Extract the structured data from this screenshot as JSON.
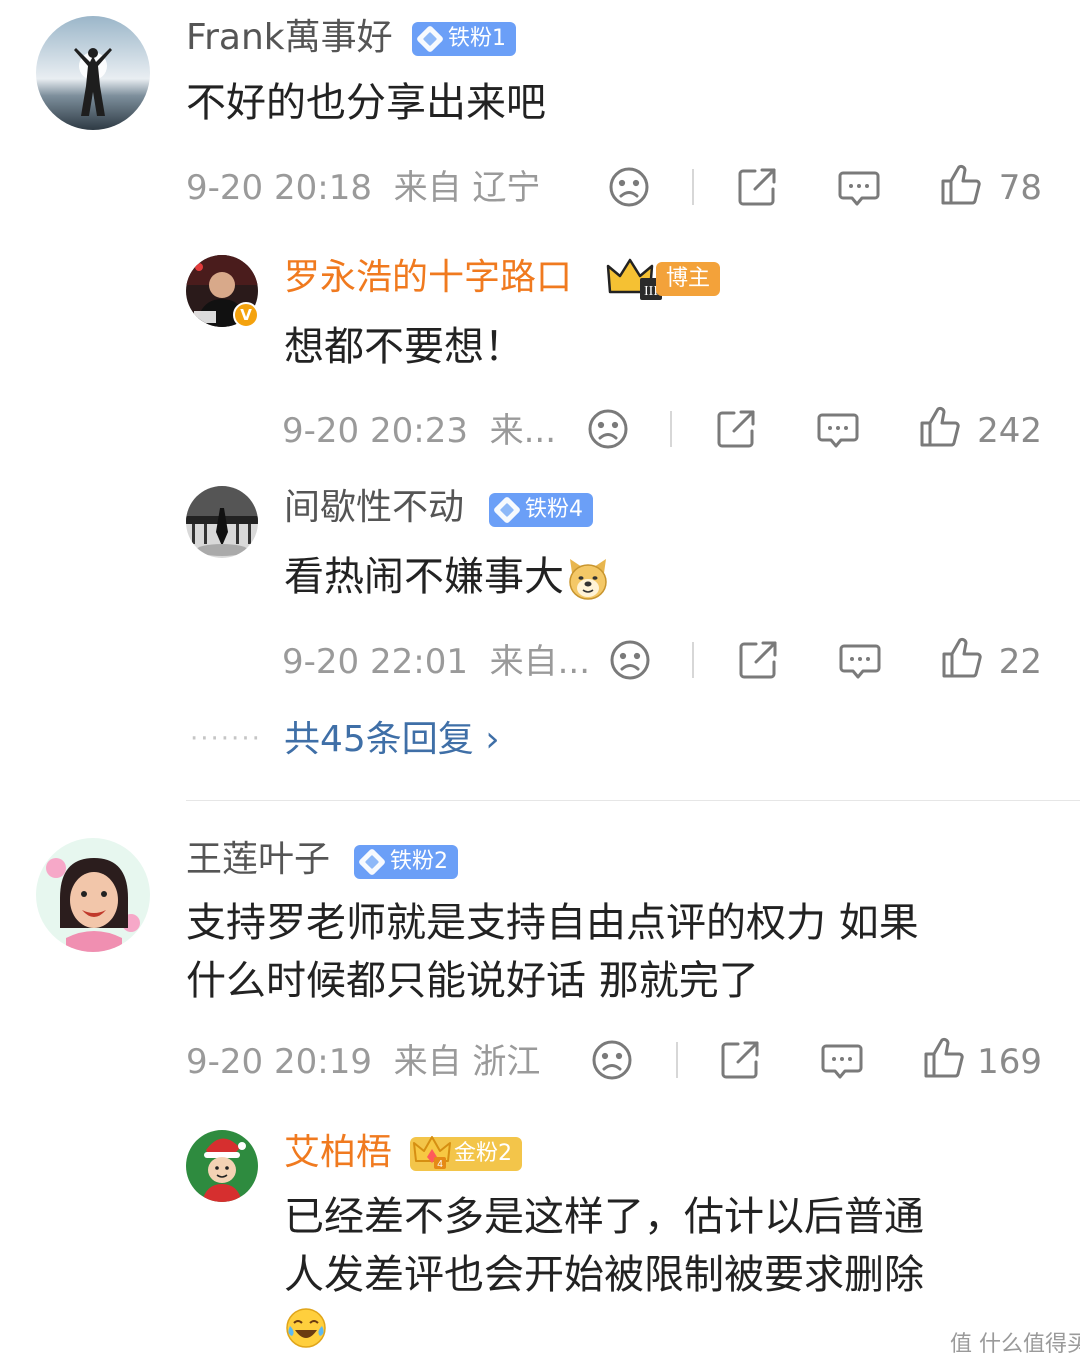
{
  "comments": [
    {
      "username": "Frank萬事好",
      "badge": "铁粉1",
      "text": "不好的也分享出来吧",
      "time": "9-20 20:18",
      "location": "来自 辽宁",
      "likes": "78",
      "replies": [
        {
          "username": "罗永浩的十字路口",
          "badge": "博主",
          "text": "想都不要想！",
          "time": "9-20 20:23",
          "location": "来...",
          "likes": "242"
        },
        {
          "username": "间歇性不动",
          "badge": "铁粉4",
          "text": "看热闹不嫌事大",
          "time": "9-20 22:01",
          "location": "来自...",
          "likes": "22"
        }
      ],
      "more_replies": "共45条回复 ›"
    },
    {
      "username": "王莲叶子",
      "badge": "铁粉2",
      "text_line1": "支持罗老师就是支持自由点评的权力 如果",
      "text_line2": "什么时候都只能说好话 那就完了",
      "time": "9-20 20:19",
      "location": "来自 浙江",
      "likes": "169",
      "replies": [
        {
          "username": "艾柏梧",
          "badge": "金粉2",
          "text_line1": "已经差不多是这样了，估计以后普通",
          "text_line2": "人发差评也会开始被限制被要求删除"
        }
      ]
    }
  ],
  "watermark": "值 什么值得买",
  "colors": {
    "accent_orange": "#f07a1f",
    "fan_badge_blue": "#6b9ff7",
    "link_blue": "#3f6fa7",
    "meta_gray": "#9a9a9a"
  },
  "icons": [
    "sad-face-icon",
    "share-icon",
    "comment-icon",
    "thumbs-up-icon",
    "doge-emoji",
    "laugh-cry-emoji",
    "crown-icon"
  ]
}
